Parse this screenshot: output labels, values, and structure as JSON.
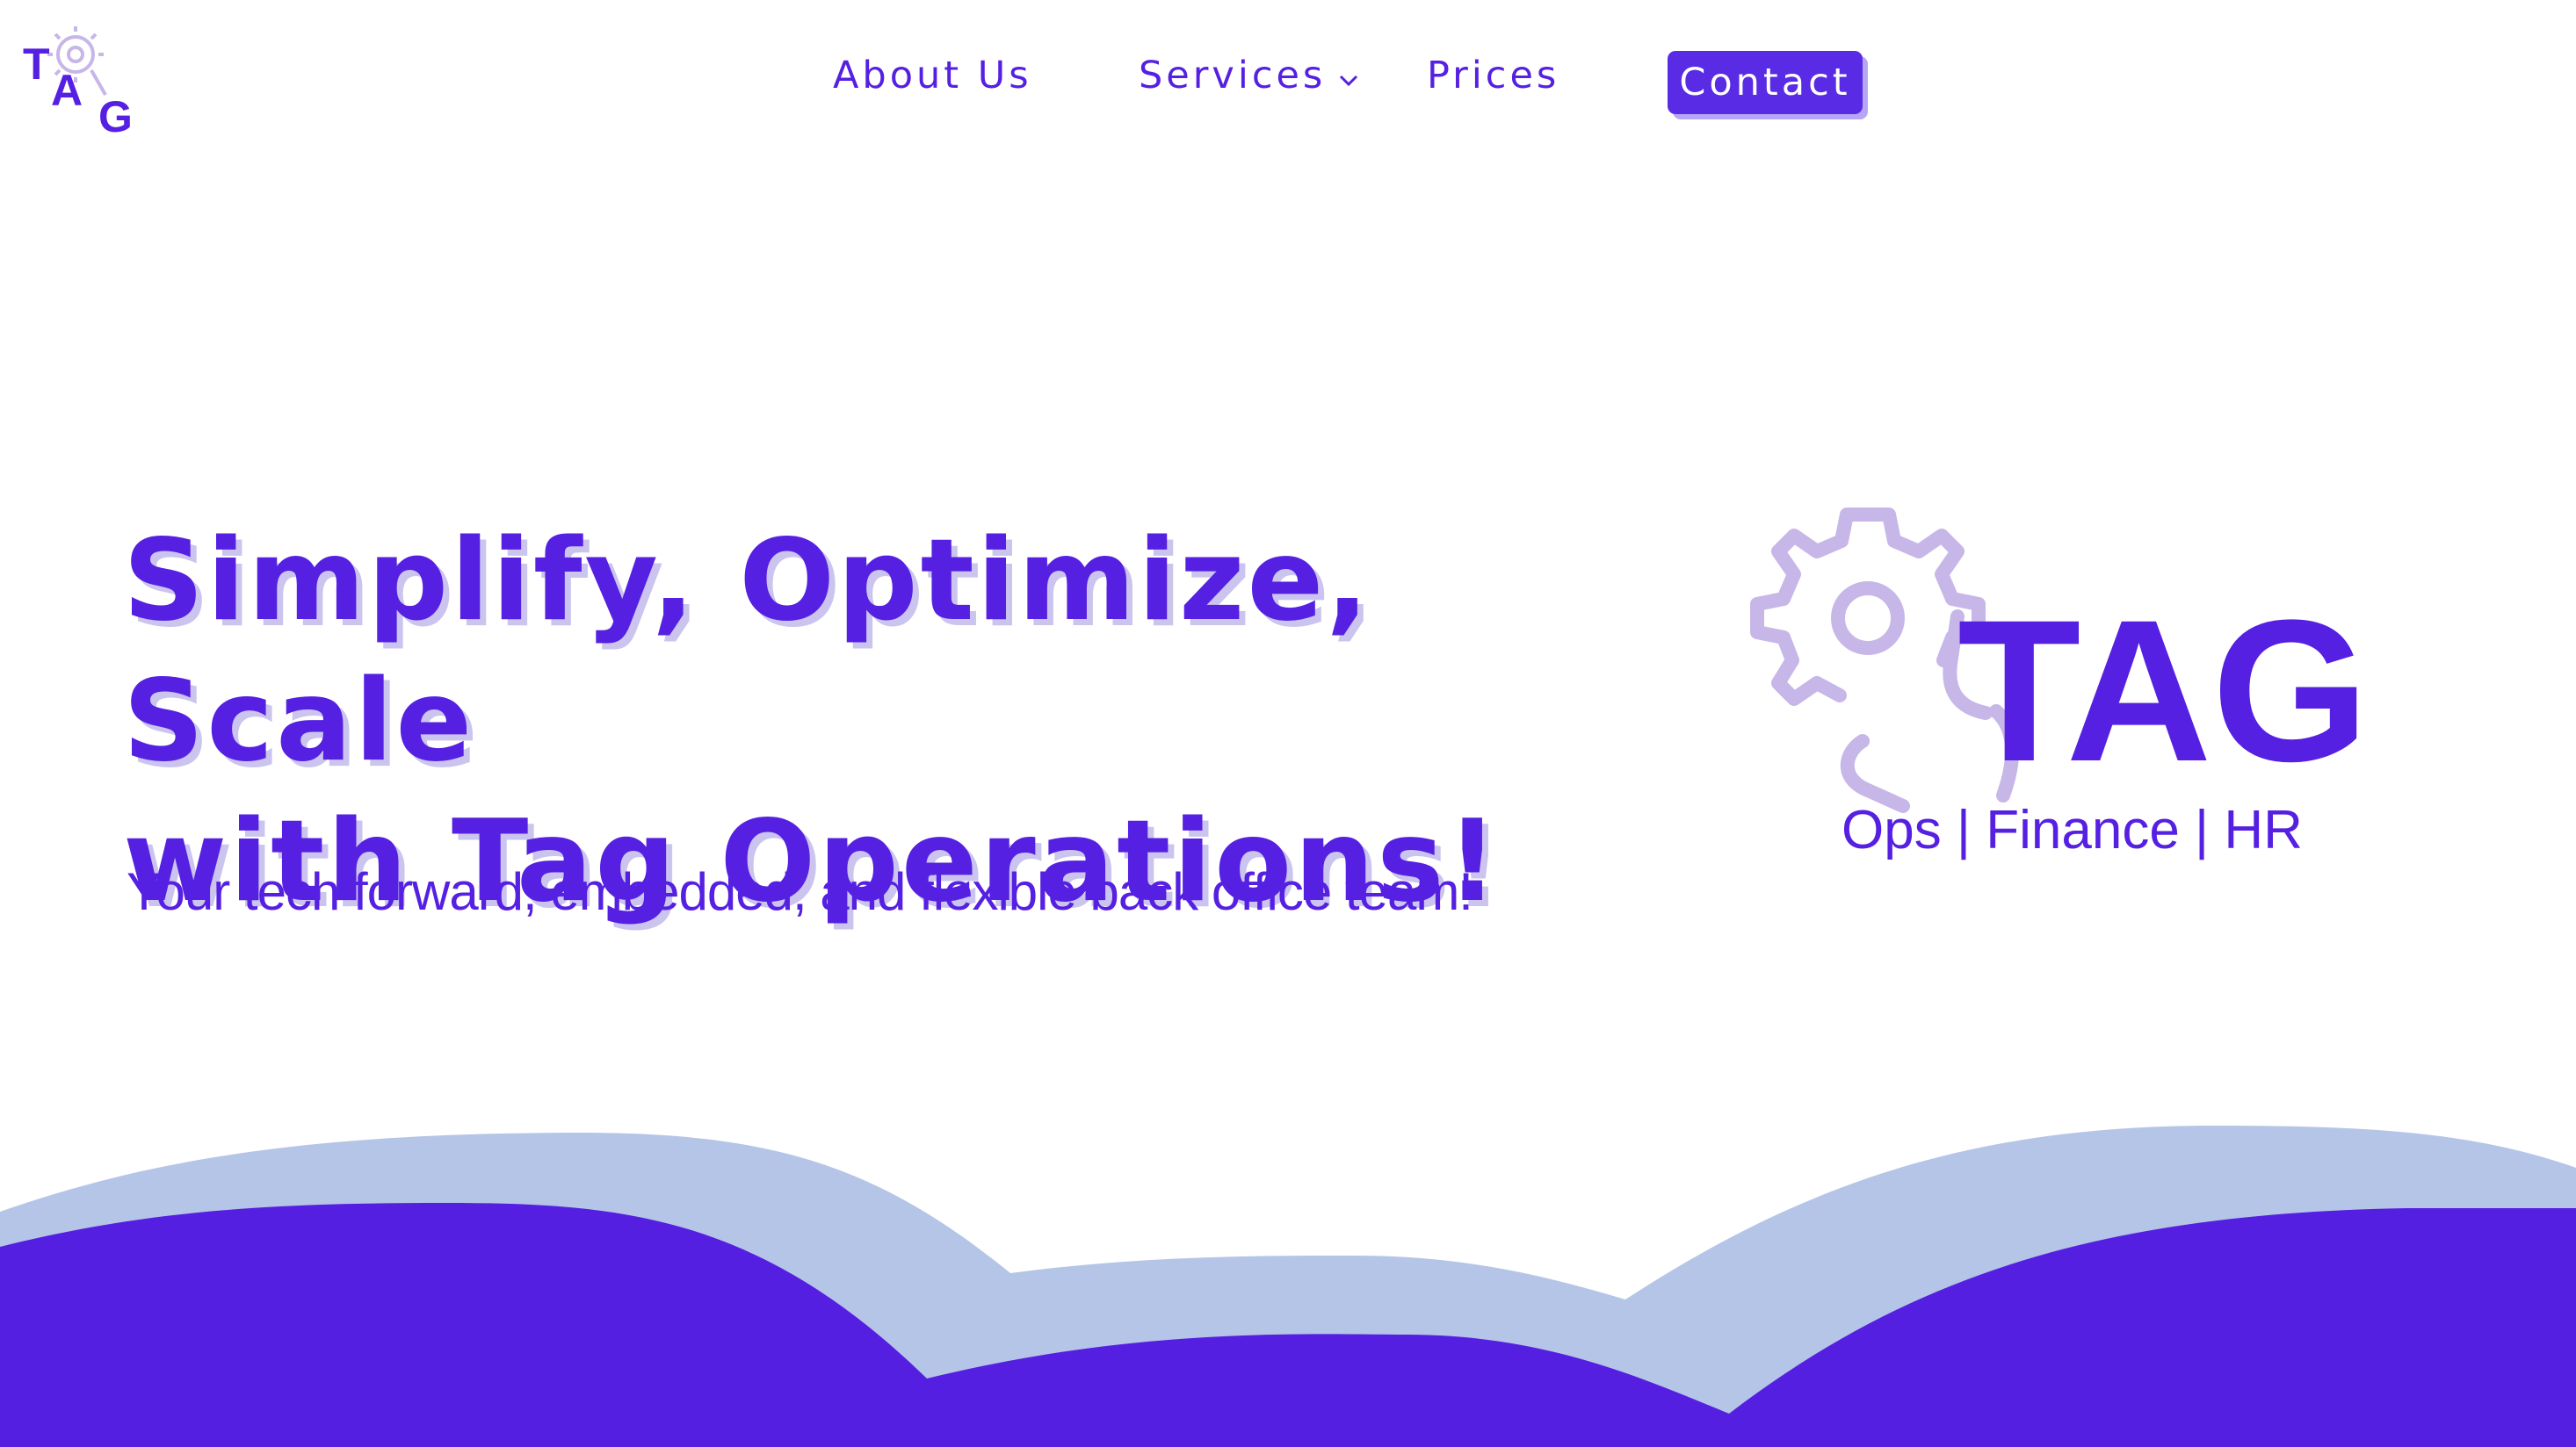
{
  "logo": {
    "text": "TAG",
    "letters": [
      "T",
      "A",
      "G"
    ],
    "icon": "gear-icon"
  },
  "nav": {
    "items": [
      {
        "label": "About Us"
      },
      {
        "label": "Services",
        "icon": "chevron-down-icon"
      },
      {
        "label": "Prices"
      }
    ],
    "contact_label": "Contact"
  },
  "hero": {
    "title_line1": "Simplify, Optimize, Scale",
    "title_line2": "with Tag Operations!",
    "subtitle": "Your tech forward, embedded, and flexible back office team!",
    "logo_text": "TAG",
    "tagline": "Ops | Finance | HR"
  },
  "colors": {
    "primary": "#5520E2",
    "light_purple": "#C7B6E8",
    "wave_light": "#B5C5E8",
    "wave_dark": "#551FE1",
    "white": "#FFFFFF"
  }
}
